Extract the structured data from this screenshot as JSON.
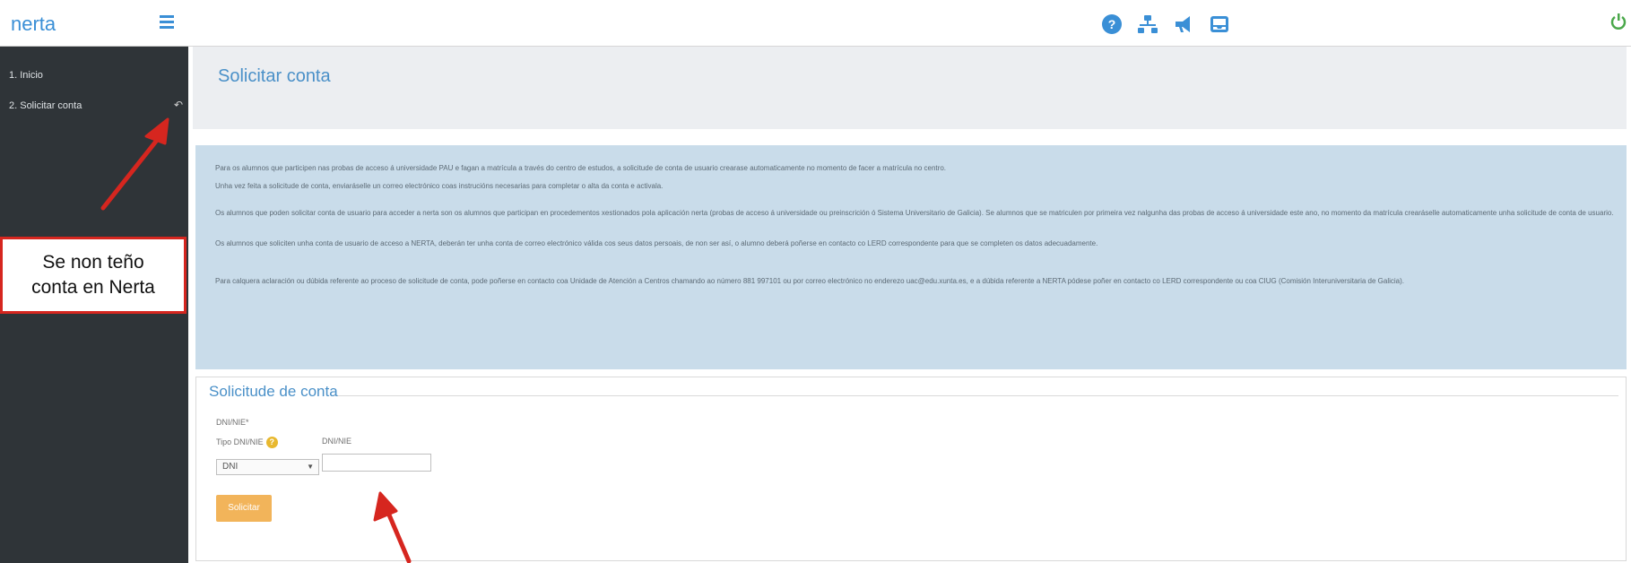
{
  "brand": {
    "name": "nerta"
  },
  "sidebar": {
    "items": [
      {
        "label": "1. Inicio"
      },
      {
        "label": "2. Solicitar conta",
        "arrow": "↶"
      }
    ]
  },
  "header": {
    "icons": [
      "help-icon",
      "network-icon",
      "megaphone-icon",
      "inbox-icon"
    ],
    "power_icon": "power-icon",
    "accent_color": "#3a8fd6"
  },
  "page": {
    "title": "Solicitar conta"
  },
  "info": {
    "paragraphs": [
      "Para os alumnos que participen nas probas de acceso á universidade PAU e fagan a matrícula a través do centro de estudos, a solicitude de conta de usuario crearase automaticamente no momento de facer a matrícula no centro.",
      "Unha vez feita a solicitude de conta, enviaráselle un correo electrónico coas instrucións necesarias para completar o alta da conta e activala.",
      "Os alumnos que poden solicitar conta de usuario para acceder a nerta son os alumnos que participan en procedementos xestionados pola aplicación nerta (probas de acceso á universidade ou preinscrición ó Sistema Universitario de Galicia). Se alumnos que se matriculen por primeira vez nalgunha das probas de acceso á universidade este ano, no momento da matrícula crearáselle automaticamente unha solicitude de conta de usuario.",
      "Os alumnos que soliciten unha conta de usuario de acceso a NERTA, deberán ter unha conta de correo electrónico válida cos seus datos persoais, de non ser así, o alumno deberá poñerse en contacto co LERD correspondente para que se completen os datos adecuadamente.",
      "Para calquera aclaración ou dúbida referente ao proceso de solicitude de conta, pode poñerse en contacto coa Unidade de Atención a Centros chamando ao número 881 997101 ou por correo electrónico no enderezo uac@edu.xunta.es, e a dúbida referente a NERTA pódese poñer en contacto co LERD correspondente ou coa CIUG (Comisión Interuniversitaria de Galicia)."
    ]
  },
  "form": {
    "legend": "Solicitude de conta",
    "section_label": "DNI/NIE*",
    "doc_type_label": "Tipo DNI/NIE",
    "doc_type_value": "DNI",
    "doc_number_label": "DNI/NIE",
    "doc_number_value": "",
    "submit_label": "Solicitar",
    "button_color": "#f2b45a"
  },
  "callout": {
    "lines": [
      "Se non teño",
      "conta en Nerta"
    ],
    "border_color": "#d6261f"
  }
}
